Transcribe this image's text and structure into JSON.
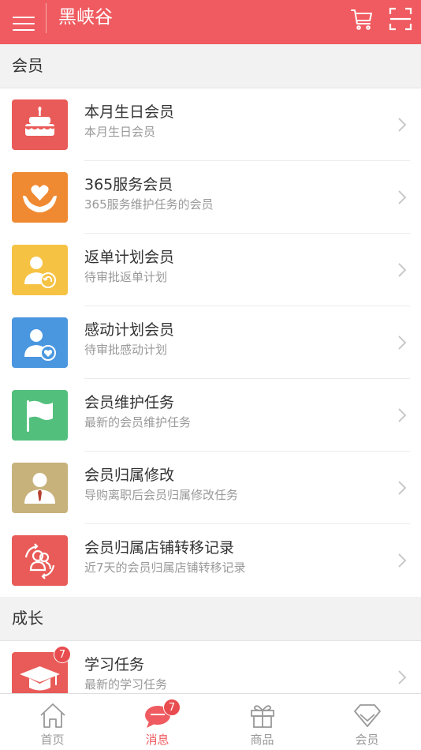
{
  "header": {
    "title": "黑峡谷",
    "menu_icon": "hamburger-menu-icon",
    "cart_icon": "shopping-cart-icon",
    "scan_icon": "scan-icon",
    "background_color": "#ef5b60"
  },
  "sections": [
    {
      "title": "会员",
      "items": [
        {
          "title": "本月生日会员",
          "subtitle": "本月生日会员",
          "icon": "birthday-cake-icon",
          "color": "#e95b58"
        },
        {
          "title": "365服务会员",
          "subtitle": "365服务维护任务的会员",
          "icon": "heart-hands-icon",
          "color": "#f08a32"
        },
        {
          "title": "返单计划会员",
          "subtitle": "待审批返单计划",
          "icon": "user-return-icon",
          "color": "#f6c243"
        },
        {
          "title": "感动计划会员",
          "subtitle": "待审批感动计划",
          "icon": "user-heart-icon",
          "color": "#4a97e0"
        },
        {
          "title": "会员维护任务",
          "subtitle": "最新的会员维护任务",
          "icon": "flag-icon",
          "color": "#52c07c"
        },
        {
          "title": "会员归属修改",
          "subtitle": "导购离职后会员归属修改任务",
          "icon": "user-tie-icon",
          "color": "#c8b27c"
        },
        {
          "title": "会员归属店铺转移记录",
          "subtitle": "近7天的会员归属店铺转移记录",
          "icon": "users-transfer-icon",
          "color": "#e95b58"
        }
      ]
    },
    {
      "title": "成长",
      "items": [
        {
          "title": "学习任务",
          "subtitle": "最新的学习任务",
          "icon": "graduation-cap-icon",
          "color": "#e95b58",
          "badge": "7"
        }
      ]
    }
  ],
  "tabbar": {
    "tabs": [
      {
        "label": "首页",
        "icon": "home-icon",
        "active": false
      },
      {
        "label": "消息",
        "icon": "message-bubble-icon",
        "active": true,
        "badge": "7"
      },
      {
        "label": "商品",
        "icon": "gift-icon",
        "active": false
      },
      {
        "label": "会员",
        "icon": "diamond-icon",
        "active": false
      }
    ],
    "active_color": "#ef5b60"
  }
}
